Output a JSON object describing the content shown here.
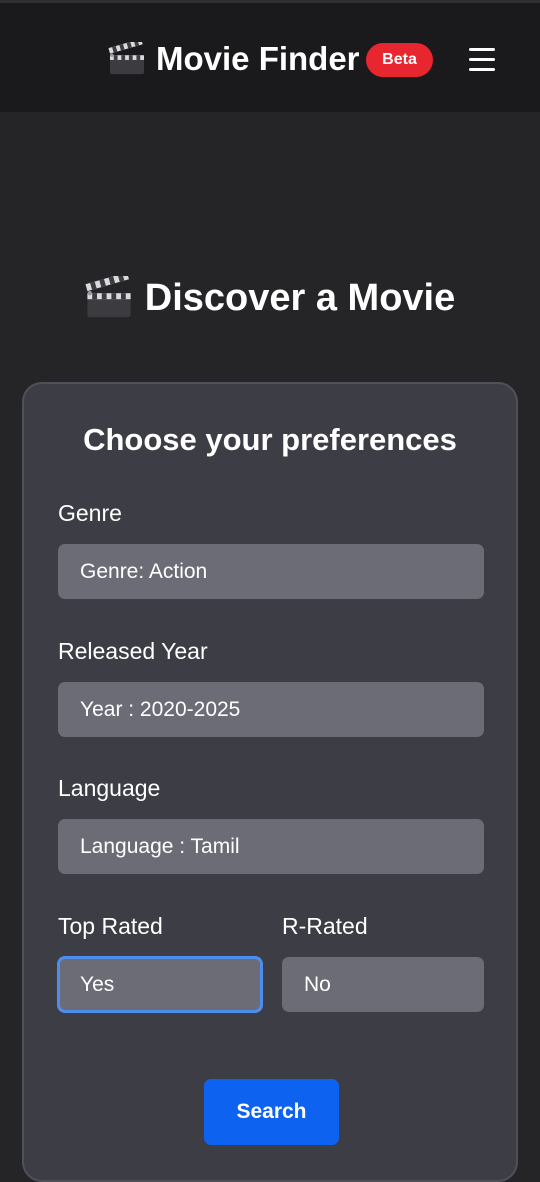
{
  "navbar": {
    "brand_title": "Movie Finder",
    "brand_icon": "clapperboard-icon",
    "badge": "Beta",
    "menu_icon": "hamburger-menu-icon"
  },
  "hero": {
    "title": "Discover a Movie",
    "icon": "clapperboard-icon"
  },
  "form": {
    "title": "Choose your preferences",
    "genre": {
      "label": "Genre",
      "value": "Genre: Action"
    },
    "year": {
      "label": "Released Year",
      "value": "Year : 2020-2025"
    },
    "language": {
      "label": "Language",
      "value": "Language : Tamil"
    },
    "top_rated": {
      "label": "Top Rated",
      "value": "Yes"
    },
    "r_rated": {
      "label": "R-Rated",
      "value": "No"
    },
    "search_label": "Search"
  },
  "colors": {
    "background": "#252528",
    "navbar": "#1a1a1c",
    "card": "#3d3d45",
    "field": "#6c6c76",
    "badge": "#e8262f",
    "primary": "#0d63f0",
    "focus": "#4e8df0"
  }
}
